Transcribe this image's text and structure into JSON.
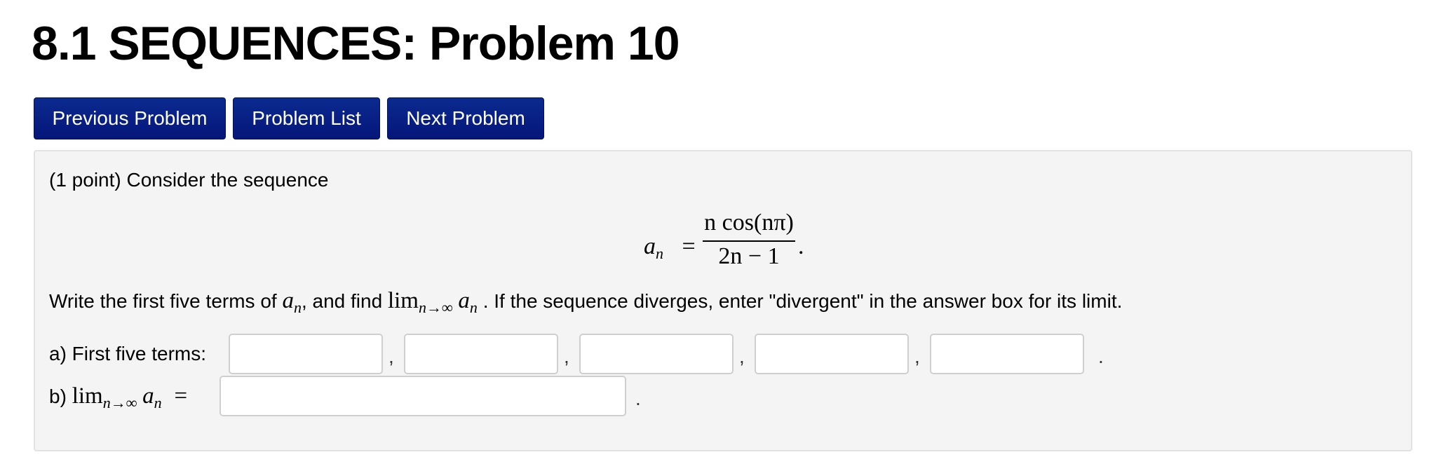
{
  "page": {
    "title": "8.1 SEQUENCES: Problem 10"
  },
  "nav": {
    "previous": "Previous Problem",
    "list": "Problem List",
    "next": "Next Problem"
  },
  "problem": {
    "intro": "(1 point) Consider the sequence",
    "equation": {
      "lhs": "a",
      "lhs_sub": "n",
      "equals": "=",
      "numerator": "n cos(nπ)",
      "denominator": "2n − 1",
      "trailing": "."
    },
    "instruction": {
      "part1": "Write the first five terms of",
      "var": "a",
      "var_sub": "n",
      "part2": ", and find",
      "lim": "lim",
      "lim_sub": "n→∞",
      "lim_var": "a",
      "lim_var_sub": "n",
      "part3": ". If the sequence diverges, enter \"divergent\" in the answer box for its limit."
    },
    "part_a": {
      "label": "a) First five terms:",
      "separator": ",",
      "end": ".",
      "values": [
        "",
        "",
        "",
        "",
        ""
      ]
    },
    "part_b": {
      "prefix": "b)",
      "lim": "lim",
      "lim_sub": "n→∞",
      "var": "a",
      "var_sub": "n",
      "equals": "=",
      "value": "",
      "end": "."
    }
  }
}
